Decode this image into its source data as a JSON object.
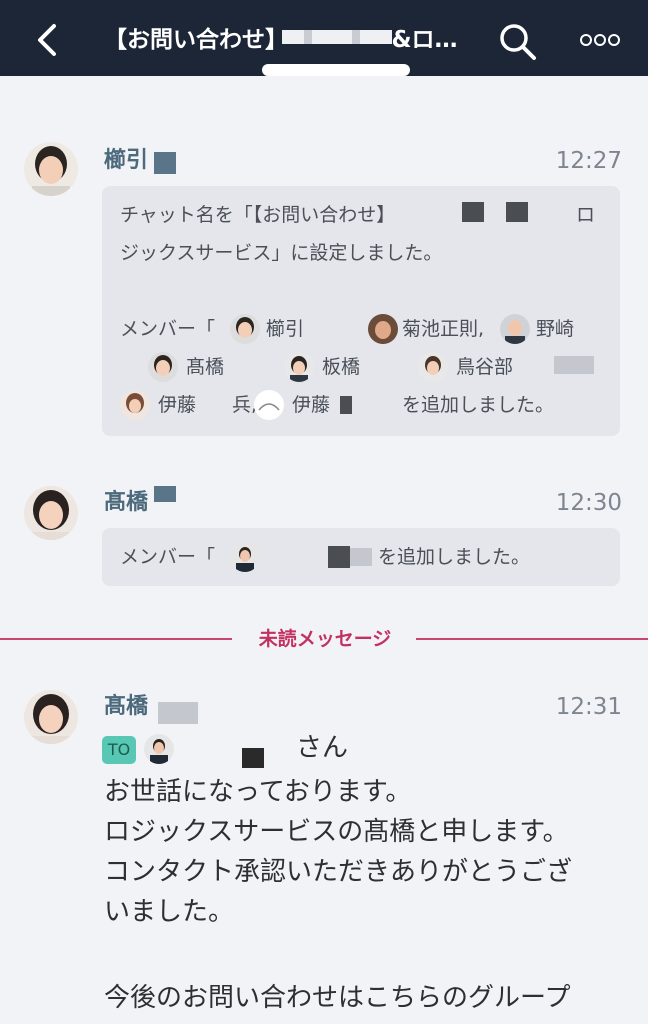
{
  "header": {
    "title": "【お問い合わせ】　　　　　&ロ…",
    "back_icon": "chevron-left-icon",
    "search_icon": "search-icon",
    "more_icon": "more-icon"
  },
  "messages": [
    {
      "sender": "櫛引",
      "time": "12:27",
      "lines": [
        "チャット名を「【お問い合わせ】",
        "ロ",
        "ジックスサービス」に設定しました。",
        "メンバー「",
        "櫛引",
        "菊池正則,",
        "野崎",
        "髙橋",
        "板橋",
        "鳥谷部",
        "伊藤",
        "兵,",
        "伊藤",
        "を追加しました。"
      ]
    },
    {
      "sender": "髙橋",
      "time": "12:30",
      "lines": [
        "メンバー「",
        "を追加しました。"
      ]
    }
  ],
  "unread_divider": "未読メッセージ",
  "last_message": {
    "sender": "髙橋",
    "time": "12:31",
    "to_badge": "TO",
    "to_suffix": "さん",
    "body": [
      "お世話になっております。",
      "ロジックスサービスの髙橋と申します。",
      "コンタクト承認いただきありがとうござ",
      "いました。",
      "",
      "今後のお問い合わせはこちらのグループ"
    ]
  },
  "colors": {
    "header_bg": "#1c2637",
    "background": "#f2f3f7",
    "bubble_bg": "#e4e6ec",
    "sender_name": "#4c6a7c",
    "unread_accent": "#c2315f",
    "to_badge": "#58c8b4"
  }
}
